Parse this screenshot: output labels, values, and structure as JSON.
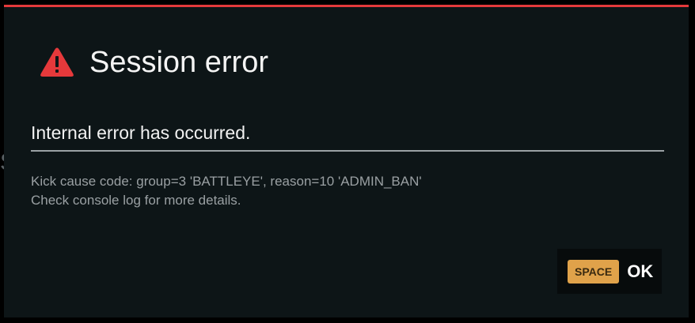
{
  "backdrop": {
    "partial_text": "S"
  },
  "dialog": {
    "accent_color": "#e5393b",
    "icon": "warning-triangle-icon",
    "title": "Session error",
    "message": "Internal error has occurred.",
    "details": [
      "Kick cause code: group=3 'BATTLEYE', reason=10 'ADMIN_BAN'",
      "Check console log for more details."
    ],
    "action": {
      "key_hint": "SPACE",
      "label": "OK",
      "key_color": "#e0a24a"
    }
  }
}
